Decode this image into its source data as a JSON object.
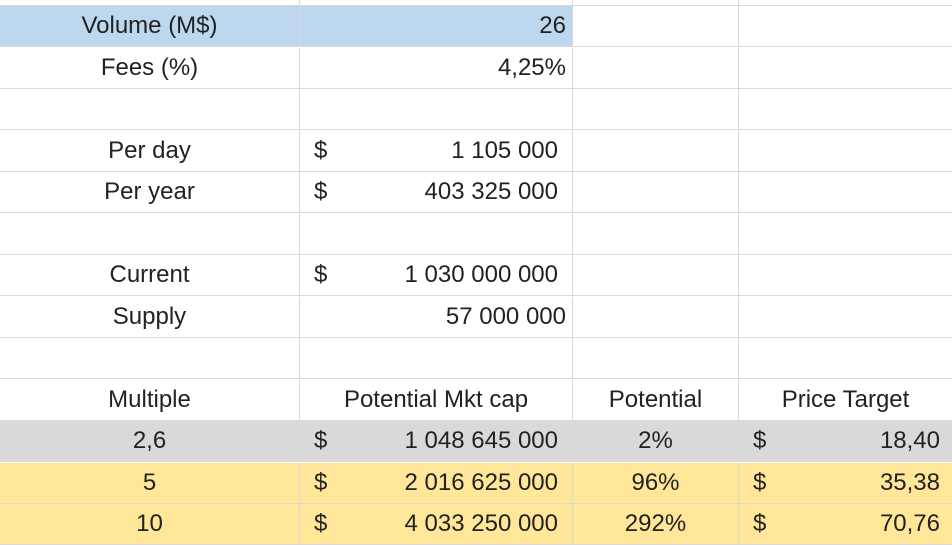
{
  "colors": {
    "highlight_blue": "#bdd7ee",
    "highlight_gray": "#d9d9d9",
    "highlight_yellow": "#ffe699"
  },
  "inputs": {
    "volume": {
      "label": "Volume (M$)",
      "value": "26"
    },
    "fees": {
      "label": "Fees (%)",
      "value": "4,25%"
    }
  },
  "revenue": {
    "per_day": {
      "label": "Per day",
      "currency": "$",
      "value": "1 105 000"
    },
    "per_year": {
      "label": "Per year",
      "currency": "$",
      "value": "403 325 000"
    }
  },
  "market": {
    "current": {
      "label": "Current",
      "currency": "$",
      "value": "1 030 000 000"
    },
    "supply": {
      "label": "Supply",
      "value": "57 000 000"
    }
  },
  "table": {
    "headers": [
      "Multiple",
      "Potential Mkt cap",
      "Potential",
      "Price Target"
    ],
    "rows": [
      {
        "multiple": "2,6",
        "cap_currency": "$",
        "cap": "1 048 645 000",
        "potential": "2%",
        "pt_currency": "$",
        "price_target": "18,40"
      },
      {
        "multiple": "5",
        "cap_currency": "$",
        "cap": "2 016 625 000",
        "potential": "96%",
        "pt_currency": "$",
        "price_target": "35,38"
      },
      {
        "multiple": "10",
        "cap_currency": "$",
        "cap": "4 033 250 000",
        "potential": "292%",
        "pt_currency": "$",
        "price_target": "70,76"
      }
    ]
  }
}
